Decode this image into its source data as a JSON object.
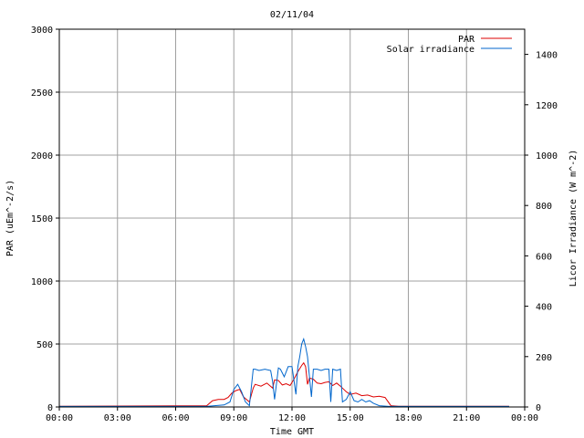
{
  "chart_data": {
    "type": "line",
    "title": "02/11/04",
    "xlabel": "Time GMT",
    "ylabel_left": "PAR (uEm^-2/s)",
    "ylabel_right": "Licor Irradiance (W m^-2)",
    "xlim": [
      0,
      24
    ],
    "ylim_left": [
      0,
      3000
    ],
    "ylim_right": [
      0,
      1500
    ],
    "x_ticks": [
      0,
      3,
      6,
      9,
      12,
      15,
      18,
      21,
      24
    ],
    "x_tick_labels": [
      "00:00",
      "03:00",
      "06:00",
      "09:00",
      "12:00",
      "15:00",
      "18:00",
      "21:00",
      "00:00"
    ],
    "y_left_ticks": [
      0,
      500,
      1000,
      1500,
      2000,
      2500,
      3000
    ],
    "y_left_tick_labels": [
      "0",
      "500",
      "1000",
      "1500",
      "2000",
      "2500",
      "3000"
    ],
    "y_right_ticks": [
      0,
      200,
      400,
      600,
      800,
      1000,
      1200,
      1400
    ],
    "y_right_tick_labels": [
      "0",
      "200",
      "400",
      "600",
      "800",
      "1000",
      "1200",
      "1400"
    ],
    "grid": true,
    "legend_position": "top-right",
    "series": [
      {
        "name": "PAR",
        "axis": "left",
        "color": "#dd0000",
        "x": [
          0,
          7.6,
          7.9,
          8.2,
          8.5,
          8.7,
          8.9,
          9.1,
          9.3,
          9.5,
          9.8,
          10.0,
          10.1,
          10.4,
          10.7,
          11.0,
          11.1,
          11.3,
          11.5,
          11.7,
          11.9,
          12.1,
          12.3,
          12.5,
          12.6,
          12.7,
          12.8,
          12.9,
          13.1,
          13.3,
          13.5,
          13.7,
          13.9,
          14.1,
          14.3,
          14.5,
          14.6,
          14.8,
          15.0,
          15.3,
          15.6,
          15.9,
          16.2,
          16.5,
          16.8,
          17.1,
          17.5,
          23.2
        ],
        "y": [
          5,
          10,
          50,
          60,
          60,
          75,
          110,
          130,
          140,
          80,
          40,
          150,
          180,
          165,
          190,
          150,
          215,
          210,
          175,
          185,
          170,
          220,
          280,
          330,
          350,
          320,
          180,
          230,
          220,
          190,
          185,
          195,
          200,
          170,
          190,
          165,
          150,
          120,
          100,
          110,
          90,
          95,
          80,
          85,
          75,
          10,
          5,
          5
        ]
      },
      {
        "name": "Solar irradiance",
        "axis": "right",
        "color": "#0066cc",
        "x": [
          0,
          7.6,
          8.0,
          8.5,
          8.8,
          9.0,
          9.2,
          9.4,
          9.6,
          9.8,
          10.0,
          10.1,
          10.3,
          10.6,
          10.9,
          11.0,
          11.1,
          11.3,
          11.4,
          11.6,
          11.8,
          12.0,
          12.2,
          12.3,
          12.4,
          12.5,
          12.6,
          12.7,
          12.8,
          13.0,
          13.1,
          13.3,
          13.5,
          13.7,
          13.9,
          14.0,
          14.1,
          14.3,
          14.5,
          14.6,
          14.8,
          15.0,
          15.2,
          15.4,
          15.6,
          15.8,
          16.0,
          16.2,
          16.5,
          17.0,
          23.2
        ],
        "y": [
          2,
          2,
          5,
          8,
          20,
          70,
          90,
          60,
          20,
          5,
          150,
          150,
          145,
          150,
          145,
          100,
          30,
          155,
          150,
          120,
          160,
          160,
          50,
          160,
          200,
          250,
          270,
          240,
          200,
          40,
          150,
          150,
          145,
          150,
          150,
          20,
          150,
          145,
          150,
          20,
          30,
          60,
          25,
          20,
          30,
          20,
          25,
          15,
          5,
          2,
          2
        ]
      }
    ]
  }
}
